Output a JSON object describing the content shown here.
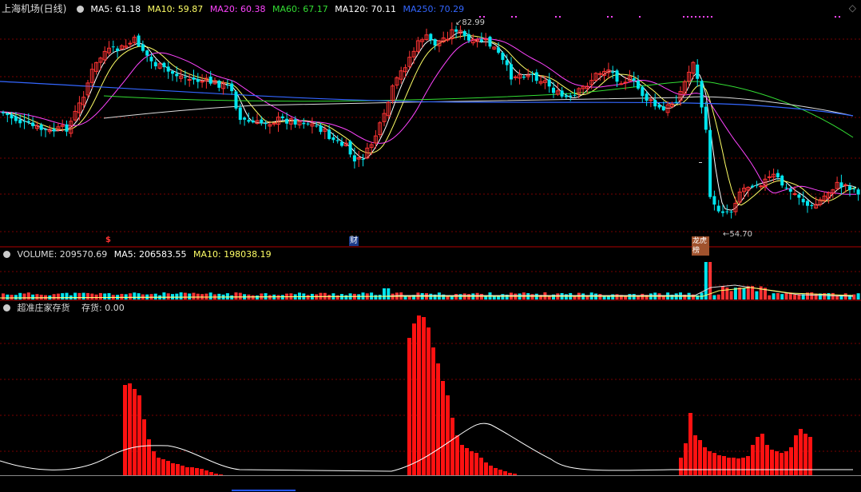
{
  "colors": {
    "up": "#ff3333",
    "down": "#00e5ee",
    "ma5": "#ffffff",
    "ma10": "#ffff66",
    "ma20": "#ff44ff",
    "ma60": "#33dd33",
    "ma120": "#ffffff",
    "ma250": "#3366ff",
    "grid": "#7a0000",
    "hist": "#ff1111"
  },
  "main_panel": {
    "title": "上海机场(日线)",
    "ma_labels": [
      "MA5: 61.18",
      "MA10: 59.87",
      "MA20: 60.38",
      "MA60: 67.17",
      "MA120: 70.11",
      "MA250: 70.29"
    ],
    "high_label": "82.99",
    "low_label": "54.70",
    "markers": [
      {
        "text": "$",
        "kind": "dollar"
      },
      {
        "text": "财",
        "kind": "finance"
      },
      {
        "text": "龙虎榜",
        "kind": "ranking"
      }
    ]
  },
  "volume_panel": {
    "labels": [
      "VOLUME: 209570.69",
      "MA5: 206583.55",
      "MA10: 198038.19"
    ]
  },
  "indicator_panel": {
    "title": "超准庄家存货",
    "label": "存货: 0.00"
  },
  "chart_data": [
    {
      "type": "candlestick",
      "title": "上海机场(日线)",
      "series_names": [
        "MA5",
        "MA10",
        "MA20",
        "MA60",
        "MA120",
        "MA250"
      ],
      "latest_ma_values": [
        61.18,
        59.87,
        60.38,
        67.17,
        70.11,
        70.29
      ],
      "highest_price": 82.99,
      "lowest_price": 54.7
    },
    {
      "type": "bar",
      "title": "VOLUME",
      "latest_values": {
        "VOLUME": 209570.69,
        "MA5": 206583.55,
        "MA10": 198038.19
      }
    },
    {
      "type": "bar",
      "title": "超准庄家存货",
      "latest_values": {
        "存货": 0.0
      }
    }
  ]
}
